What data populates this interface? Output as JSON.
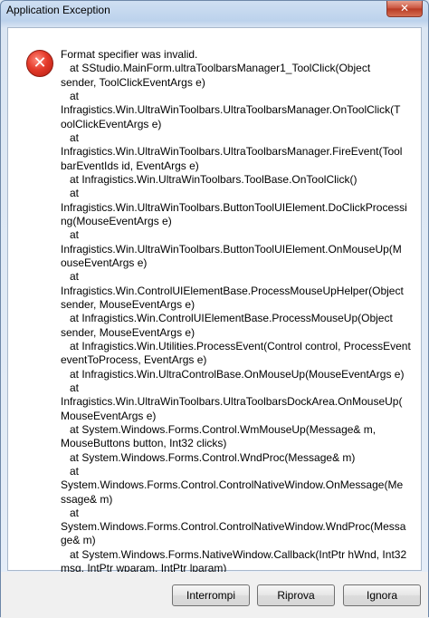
{
  "window": {
    "title": "Application Exception",
    "close_symbol": "✕"
  },
  "icon": {
    "name": "error-icon",
    "symbol": "✕"
  },
  "message": {
    "lines": [
      "Format specifier was invalid.",
      "   at SStudio.MainForm.ultraToolbarsManager1_ToolClick(Object",
      "sender, ToolClickEventArgs e)",
      "   at",
      "Infragistics.Win.UltraWinToolbars.UltraToolbarsManager.OnToolClick(T",
      "oolClickEventArgs e)",
      "   at",
      "Infragistics.Win.UltraWinToolbars.UltraToolbarsManager.FireEvent(Tool",
      "barEventIds id, EventArgs e)",
      "   at Infragistics.Win.UltraWinToolbars.ToolBase.OnToolClick()",
      "   at",
      "Infragistics.Win.UltraWinToolbars.ButtonToolUIElement.DoClickProcessi",
      "ng(MouseEventArgs e)",
      "   at",
      "Infragistics.Win.UltraWinToolbars.ButtonToolUIElement.OnMouseUp(M",
      "ouseEventArgs e)",
      "   at",
      "Infragistics.Win.ControlUIElementBase.ProcessMouseUpHelper(Object",
      "sender, MouseEventArgs e)",
      "   at Infragistics.Win.ControlUIElementBase.ProcessMouseUp(Object",
      "sender, MouseEventArgs e)",
      "   at Infragistics.Win.Utilities.ProcessEvent(Control control, ProcessEvent",
      "eventToProcess, EventArgs e)",
      "   at Infragistics.Win.UltraControlBase.OnMouseUp(MouseEventArgs e)",
      "   at",
      "Infragistics.Win.UltraWinToolbars.UltraToolbarsDockArea.OnMouseUp(",
      "MouseEventArgs e)",
      "   at System.Windows.Forms.Control.WmMouseUp(Message& m,",
      "MouseButtons button, Int32 clicks)",
      "   at System.Windows.Forms.Control.WndProc(Message& m)",
      "   at",
      "System.Windows.Forms.Control.ControlNativeWindow.OnMessage(Me",
      "ssage& m)",
      "   at",
      "System.Windows.Forms.Control.ControlNativeWindow.WndProc(Messa",
      "ge& m)",
      "   at System.Windows.Forms.NativeWindow.Callback(IntPtr hWnd, Int32",
      "msg, IntPtr wparam, IntPtr lparam)"
    ]
  },
  "buttons": {
    "abort": "Interrompi",
    "retry": "Riprova",
    "ignore": "Ignora"
  }
}
